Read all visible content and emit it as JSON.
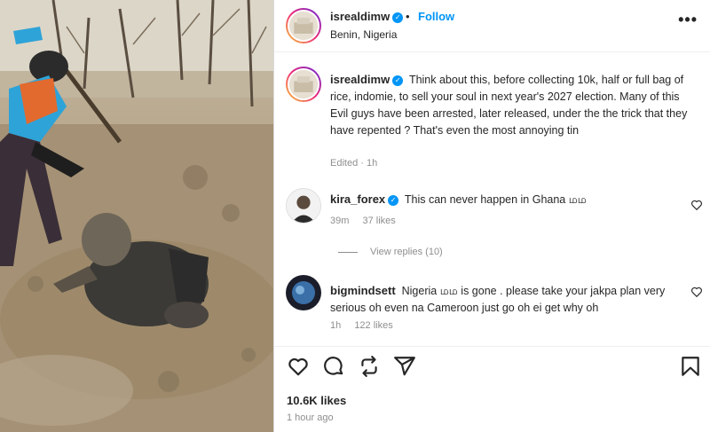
{
  "post": {
    "username": "isrealdimw",
    "follow_label": "Follow",
    "separator": "•",
    "location": "Benin, Nigeria",
    "more_label": "•••",
    "caption_text": "Think about this, before collecting 10k, half or full bag of rice, indomie, to sell your soul in next year's 2027 election. Many of this Evil guys have been arrested, later released, under the the trick that they have repented ? That's even the most annoying tin",
    "caption_meta": "Edited · 1h",
    "likes": "10.6K likes",
    "time_ago": "1 hour ago"
  },
  "comments": [
    {
      "username": "kira_forex",
      "verified": true,
      "text": "This can never happen in Ghana மம",
      "time": "39m",
      "likes": "37 likes",
      "replies": "View replies (10)"
    },
    {
      "username": "bigmindsett",
      "verified": false,
      "text": "Nigeria மம is gone . please take your jakpa plan very serious oh even na Cameroon just go oh ei get why oh",
      "time": "1h",
      "likes": "122 likes"
    }
  ],
  "icons": {
    "actions": [
      "heart-icon",
      "comment-icon",
      "repost-icon",
      "share-icon",
      "bookmark-icon"
    ]
  },
  "colors": {
    "accent": "#0095f6",
    "text": "#262626",
    "muted": "#8e8e8e"
  }
}
